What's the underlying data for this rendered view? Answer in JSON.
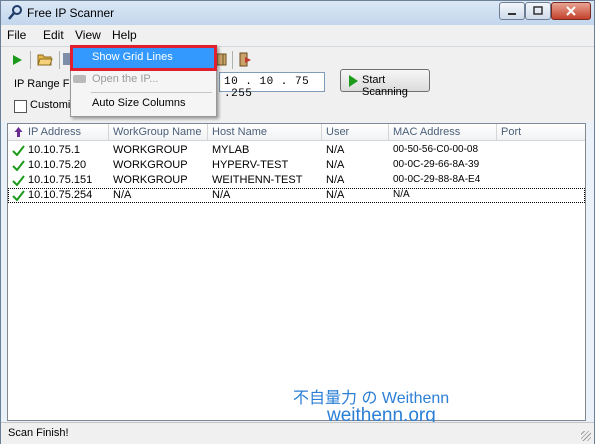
{
  "window": {
    "title": "Free IP Scanner"
  },
  "menu": {
    "file": "File",
    "edit": "Edit",
    "view": "View",
    "help": "Help"
  },
  "view_menu": {
    "items": [
      {
        "label": "Show Grid Lines",
        "state": "highlighted"
      },
      {
        "label": "Open the IP...",
        "state": "disabled"
      },
      {
        "label": "Auto Size Columns",
        "state": "normal"
      }
    ]
  },
  "toolbar": {
    "icons": [
      "start-icon",
      "open-folder-icon",
      "save-icon",
      "settings-icon",
      "exit-icon"
    ]
  },
  "form": {
    "ip_range_label": "IP Range Fro",
    "ip_end": "10 . 10 . 75 .255",
    "start_button": "Start Scanning",
    "customize_label": "Customiz"
  },
  "table": {
    "columns": [
      "IP Address",
      "WorkGroup Name",
      "Host Name",
      "User",
      "MAC Address",
      "Port"
    ],
    "rows": [
      {
        "ip": "10.10.75.1",
        "workgroup": "WORKGROUP",
        "host": "MYLAB",
        "user": "N/A",
        "mac": "00-50-56-C0-00-08",
        "port": ""
      },
      {
        "ip": "10.10.75.20",
        "workgroup": "WORKGROUP",
        "host": "HYPERV-TEST",
        "user": "N/A",
        "mac": "00-0C-29-66-8A-39",
        "port": ""
      },
      {
        "ip": "10.10.75.151",
        "workgroup": "WORKGROUP",
        "host": "WEITHENN-TEST",
        "user": "N/A",
        "mac": "00-0C-29-88-8A-E4",
        "port": ""
      },
      {
        "ip": "10.10.75.254",
        "workgroup": "N/A",
        "host": "N/A",
        "user": "N/A",
        "mac": "N/A",
        "port": ""
      }
    ]
  },
  "watermark": {
    "line1": "不自量力 の Weithenn",
    "line2": "weithenn.org"
  },
  "status": {
    "text": "Scan Finish!"
  },
  "colors": {
    "highlight": "#3399ff",
    "annotation": "#e0202e",
    "status_ok": "#1b9a1b",
    "watermark": "#2c7fd6"
  }
}
